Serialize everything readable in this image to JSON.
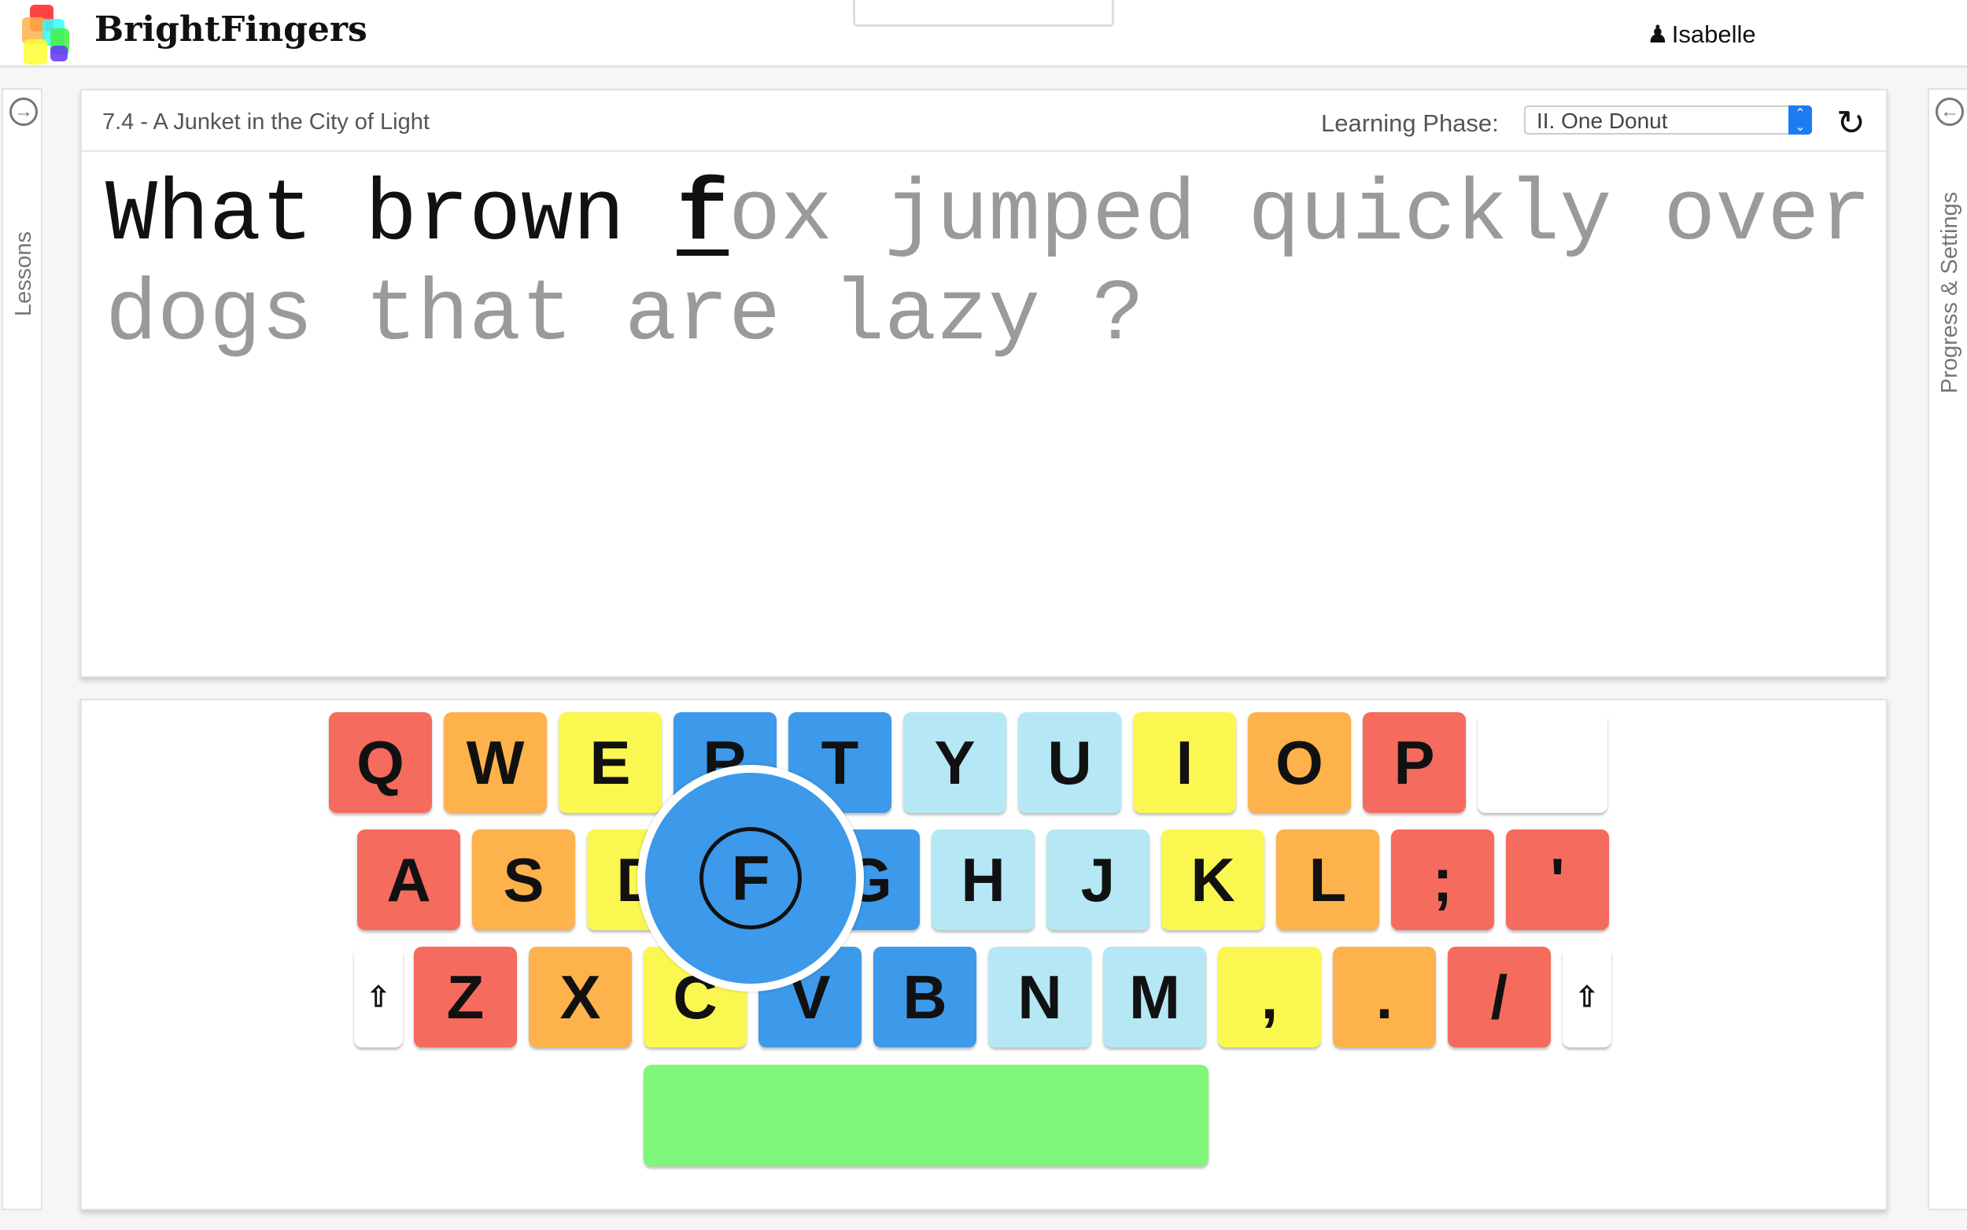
{
  "header": {
    "brand": "BrightFingers",
    "user": "Isabelle",
    "user_icon": "person-icon"
  },
  "sidebar_left": {
    "label": "Lessons",
    "icon": "arrow-right-circle-icon"
  },
  "sidebar_right": {
    "label": "Progress & Settings",
    "icon": "arrow-left-circle-icon"
  },
  "lesson": {
    "title": "7.4 - A Junket in the City of Light",
    "phase_label": "Learning Phase:",
    "phase_value": "II. One Donut",
    "refresh_icon": "refresh-icon",
    "typed": "What brown ",
    "current": "f",
    "remaining": "ox jumped quickly over dogs that are lazy ?"
  },
  "keyboard": {
    "colors": {
      "red": "#f56b5e",
      "orange": "#fdb24b",
      "yellow": "#fbf751",
      "blue": "#3d99ea",
      "light": "#b6e7f5",
      "white": "#ffffff",
      "green": "#7ef77b"
    },
    "rows": [
      [
        [
          "Q",
          "red"
        ],
        [
          "W",
          "orange"
        ],
        [
          "E",
          "yellow"
        ],
        [
          "R",
          "blue"
        ],
        [
          "T",
          "blue"
        ],
        [
          "Y",
          "light"
        ],
        [
          "U",
          "light"
        ],
        [
          "I",
          "yellow"
        ],
        [
          "O",
          "orange"
        ],
        [
          "P",
          "red"
        ],
        [
          "",
          "white"
        ]
      ],
      [
        [
          "A",
          "red"
        ],
        [
          "S",
          "orange"
        ],
        [
          "D",
          "yellow"
        ],
        [
          "F",
          "blue"
        ],
        [
          "G",
          "blue"
        ],
        [
          "H",
          "light"
        ],
        [
          "J",
          "light"
        ],
        [
          "K",
          "yellow"
        ],
        [
          "L",
          "orange"
        ],
        [
          ";",
          "red"
        ],
        [
          "'",
          "red"
        ]
      ],
      [
        [
          "⇧",
          "white"
        ],
        [
          "Z",
          "red"
        ],
        [
          "X",
          "orange"
        ],
        [
          "C",
          "yellow"
        ],
        [
          "V",
          "blue"
        ],
        [
          "B",
          "blue"
        ],
        [
          "N",
          "light"
        ],
        [
          "M",
          "light"
        ],
        [
          ",",
          "yellow"
        ],
        [
          ".",
          "orange"
        ],
        [
          "/",
          "red"
        ],
        [
          "⇧",
          "white"
        ]
      ]
    ],
    "highlighted_key": "F",
    "space_color": "green"
  }
}
